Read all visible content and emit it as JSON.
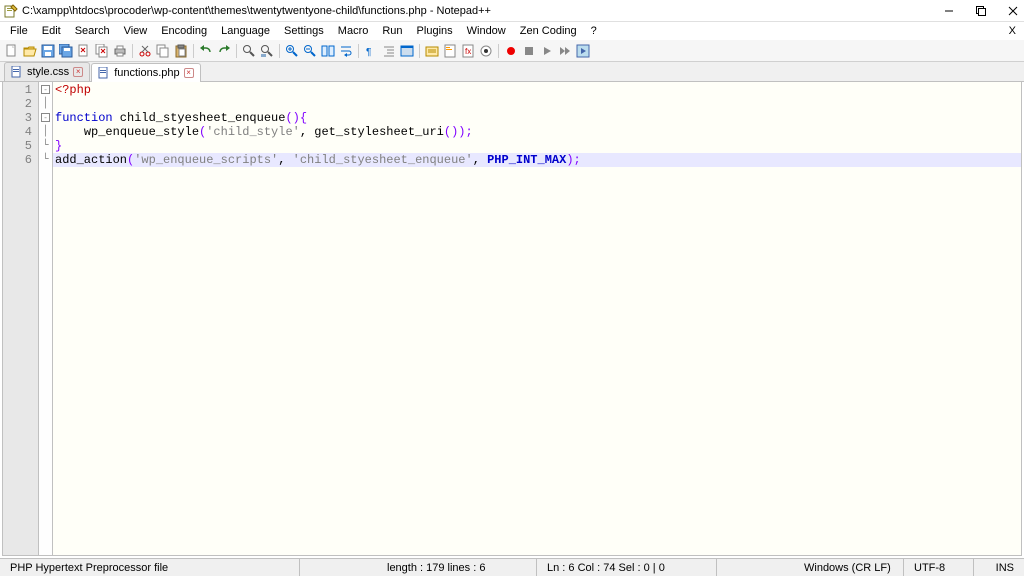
{
  "titlebar": {
    "title": "C:\\xampp\\htdocs\\procoder\\wp-content\\themes\\twentytwentyone-child\\functions.php - Notepad++"
  },
  "menu": {
    "file": "File",
    "edit": "Edit",
    "search": "Search",
    "view": "View",
    "encoding": "Encoding",
    "language": "Language",
    "settings": "Settings",
    "macro": "Macro",
    "run": "Run",
    "plugins": "Plugins",
    "window": "Window",
    "zen": "Zen Coding",
    "help": "?"
  },
  "tabs": {
    "t0": {
      "label": "style.css"
    },
    "t1": {
      "label": "functions.php"
    }
  },
  "code": {
    "l1": "<?php",
    "l2": "",
    "l3_kw": "function",
    "l3_name": " child_styesheet_enqueue",
    "l3_paren": "(){",
    "l4_indent": "    ",
    "l4_fn": "wp_enqueue_style",
    "l4_p1": "(",
    "l4_str": "'child_style'",
    "l4_c": ", ",
    "l4_fn2": "get_stylesheet_uri",
    "l4_p2": "());",
    "l5": "}",
    "l6_fn": "add_action",
    "l6_p1": "(",
    "l6_s1": "'wp_enqueue_scripts'",
    "l6_c1": ", ",
    "l6_s2": "'child_styesheet_enqueue'",
    "l6_c2": ", ",
    "l6_const": "PHP_INT_MAX",
    "l6_p2": ");"
  },
  "status": {
    "lang": "PHP Hypertext Preprocessor file",
    "length": "length : 179    lines : 6",
    "pos": "Ln : 6    Col : 74    Sel : 0 | 0",
    "eol": "Windows (CR LF)",
    "enc": "UTF-8",
    "ins": "INS"
  },
  "lines": {
    "1": "1",
    "2": "2",
    "3": "3",
    "4": "4",
    "5": "5",
    "6": "6"
  }
}
